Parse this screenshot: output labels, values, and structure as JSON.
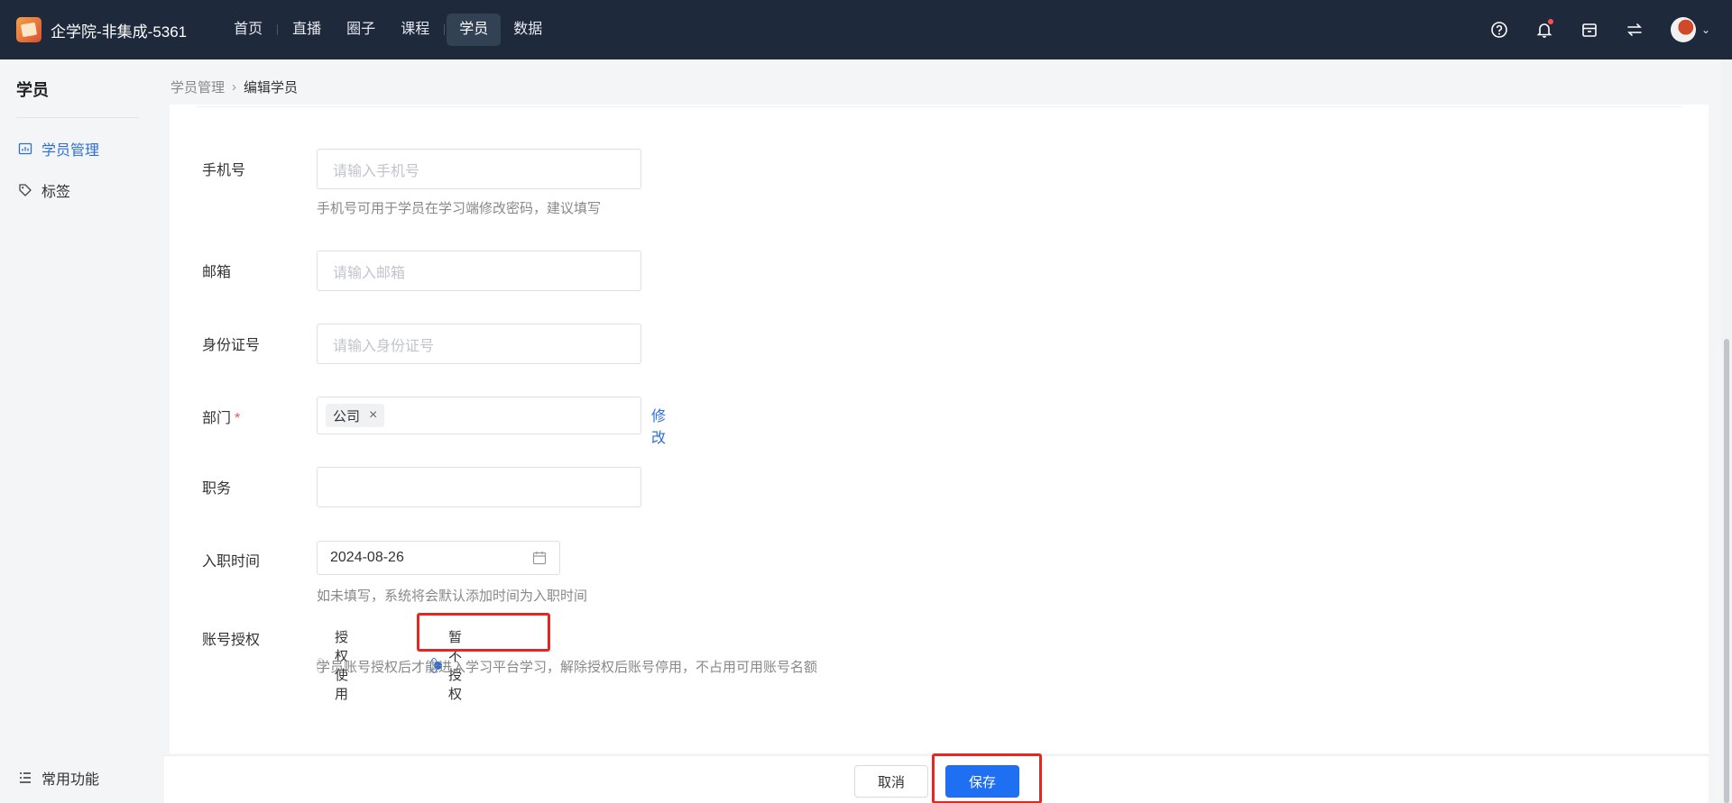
{
  "header": {
    "brand": "企学院-非集成-5361",
    "nav": [
      "首页",
      "直播",
      "圈子",
      "课程",
      "学员",
      "数据"
    ],
    "active_nav": "学员"
  },
  "sidebar": {
    "title": "学员",
    "items": [
      {
        "label": "学员管理",
        "icon": "chart-icon",
        "active": true
      },
      {
        "label": "标签",
        "icon": "tag-icon",
        "active": false
      }
    ],
    "bottom": "常用功能"
  },
  "breadcrumb": {
    "parent": "学员管理",
    "current": "编辑学员"
  },
  "form": {
    "phone": {
      "label": "手机号",
      "placeholder": "请输入手机号",
      "hint": "手机号可用于学员在学习端修改密码，建议填写"
    },
    "email": {
      "label": "邮箱",
      "placeholder": "请输入邮箱"
    },
    "id_card": {
      "label": "身份证号",
      "placeholder": "请输入身份证号"
    },
    "department": {
      "label": "部门",
      "required_mark": "*",
      "tag": "公司",
      "tag_remove": "×",
      "edit_link": "修改"
    },
    "position": {
      "label": "职务",
      "value": ""
    },
    "join_date": {
      "label": "入职时间",
      "value": "2024-08-26",
      "hint": "如未填写，系统将会默认添加时间为入职时间"
    },
    "authorization": {
      "label": "账号授权",
      "options": [
        "授权使用",
        "暂不授权"
      ],
      "selected": "暂不授权",
      "hint": "学员账号授权后才能进入学习平台学习，解除授权后账号停用，不占用可用账号名额"
    }
  },
  "footer": {
    "cancel": "取消",
    "save": "保存"
  },
  "colors": {
    "topbar": "#1e293b",
    "primary": "#1f6ff2",
    "highlight": "#e8261f"
  }
}
